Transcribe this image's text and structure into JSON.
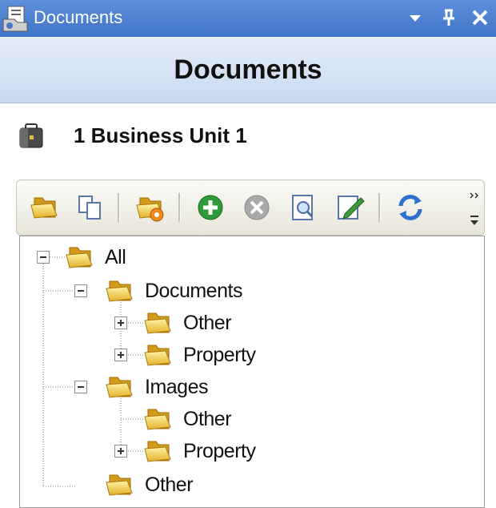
{
  "window": {
    "title": "Documents",
    "controls": [
      "dropdown-icon",
      "pin-icon",
      "close-icon"
    ]
  },
  "header": {
    "title": "Documents"
  },
  "business_unit": {
    "label": "1 Business Unit 1",
    "icon": "briefcase-icon"
  },
  "toolbar": {
    "buttons": [
      "new-folder-icon",
      "copy-icon",
      "folder-settings-icon",
      "add-icon",
      "delete-icon",
      "preview-icon",
      "edit-icon",
      "refresh-icon"
    ]
  },
  "tree": {
    "nodes": [
      {
        "label": "All",
        "level": 0,
        "state": "expanded"
      },
      {
        "label": "Documents",
        "level": 1,
        "state": "expanded"
      },
      {
        "label": "Other",
        "level": 2,
        "state": "collapsed"
      },
      {
        "label": "Property",
        "level": 2,
        "state": "collapsed"
      },
      {
        "label": "Images",
        "level": 1,
        "state": "expanded"
      },
      {
        "label": "Other",
        "level": 2,
        "state": "leaf"
      },
      {
        "label": "Property",
        "level": 2,
        "state": "collapsed"
      },
      {
        "label": "Other",
        "level": 1,
        "state": "leaf"
      }
    ]
  }
}
